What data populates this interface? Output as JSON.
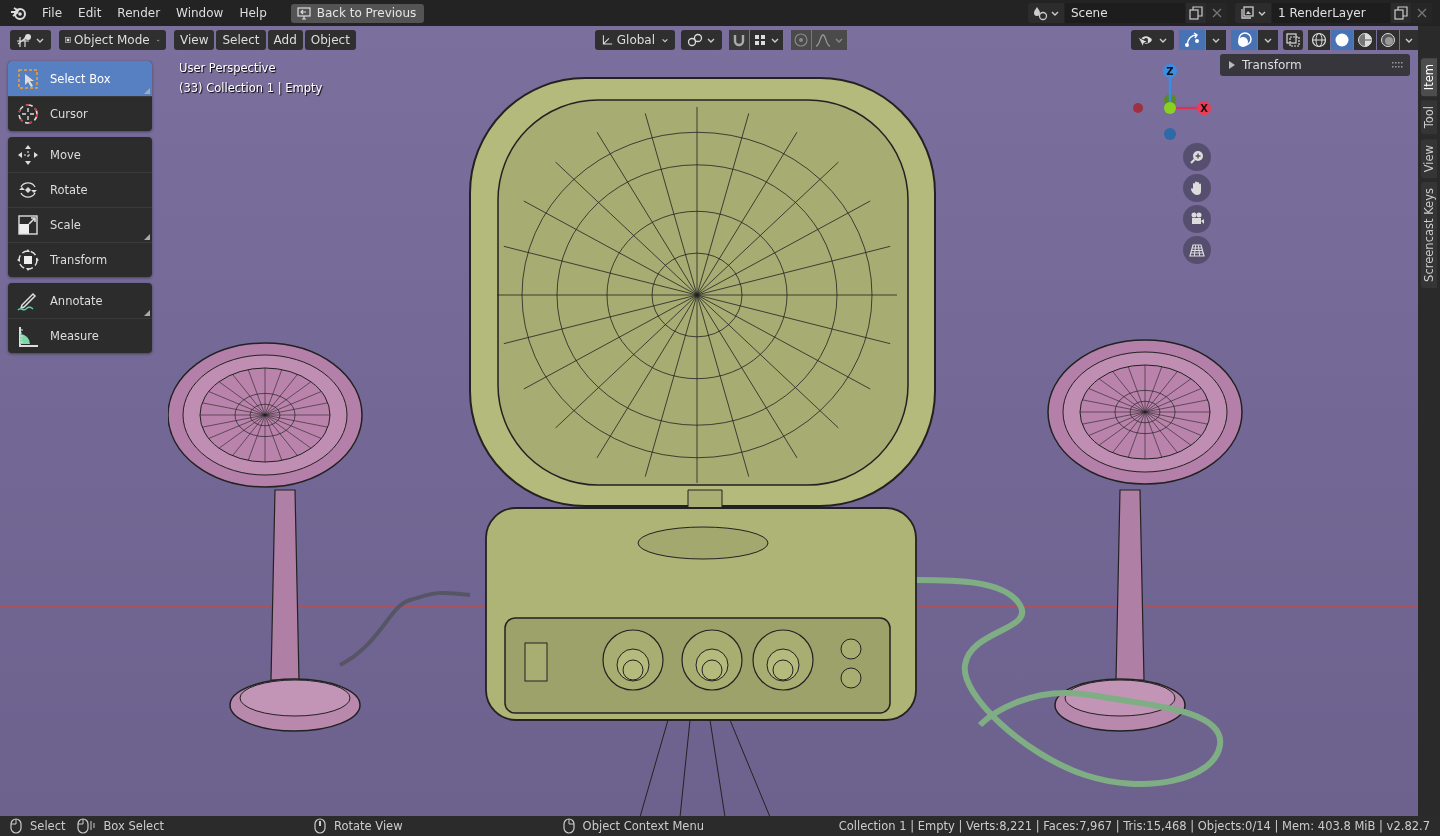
{
  "topbar": {
    "menus": [
      "File",
      "Edit",
      "Render",
      "Window",
      "Help"
    ],
    "back_button": "Back to Previous",
    "scene": "Scene",
    "view_layer": "1 RenderLayer"
  },
  "viewport_header": {
    "mode": "Object Mode",
    "menus": [
      "View",
      "Select",
      "Add",
      "Object"
    ],
    "orientation": "Global",
    "gizmos_on": true,
    "overlays_on": true,
    "xray_on": false,
    "shading": [
      {
        "selected": false
      },
      {
        "selected": true
      },
      {
        "selected": false
      },
      {
        "selected": false
      }
    ]
  },
  "overlay_text": [
    "User Perspective",
    "(33) Collection 1 | Empty"
  ],
  "toolbar": {
    "groups": [
      {
        "tools": [
          {
            "label": "Select Box",
            "selected": true,
            "more_tools": true
          },
          {
            "label": "Cursor",
            "selected": false,
            "more_tools": false
          }
        ]
      },
      {
        "tools": [
          {
            "label": "Move",
            "selected": false,
            "more_tools": false
          },
          {
            "label": "Rotate",
            "selected": false,
            "more_tools": false
          },
          {
            "label": "Scale",
            "selected": false,
            "more_tools": true
          },
          {
            "label": "Transform",
            "selected": false,
            "more_tools": false
          }
        ]
      },
      {
        "tools": [
          {
            "label": "Annotate",
            "selected": false,
            "more_tools": true
          },
          {
            "label": "Measure",
            "selected": false,
            "more_tools": false
          }
        ]
      }
    ]
  },
  "gizmo": {
    "axes": [
      "Z",
      "X"
    ]
  },
  "sidebar": {
    "panel": {
      "title": "Transform",
      "expanded": false
    },
    "tabs": [
      {
        "label": "Item",
        "selected": true
      },
      {
        "label": "Tool",
        "selected": false
      },
      {
        "label": "View",
        "selected": false
      },
      {
        "label": "Screencast Keys",
        "selected": false
      }
    ]
  },
  "status_bar": {
    "hints": [
      "Select",
      "Box Select",
      "Rotate View",
      "Object Context Menu"
    ],
    "stats": "Collection 1 | Empty | Verts:8,221 | Faces:7,967 | Tris:15,468 | Objects:0/14 | Mem: 403.8 MiB | v2.82.7"
  }
}
